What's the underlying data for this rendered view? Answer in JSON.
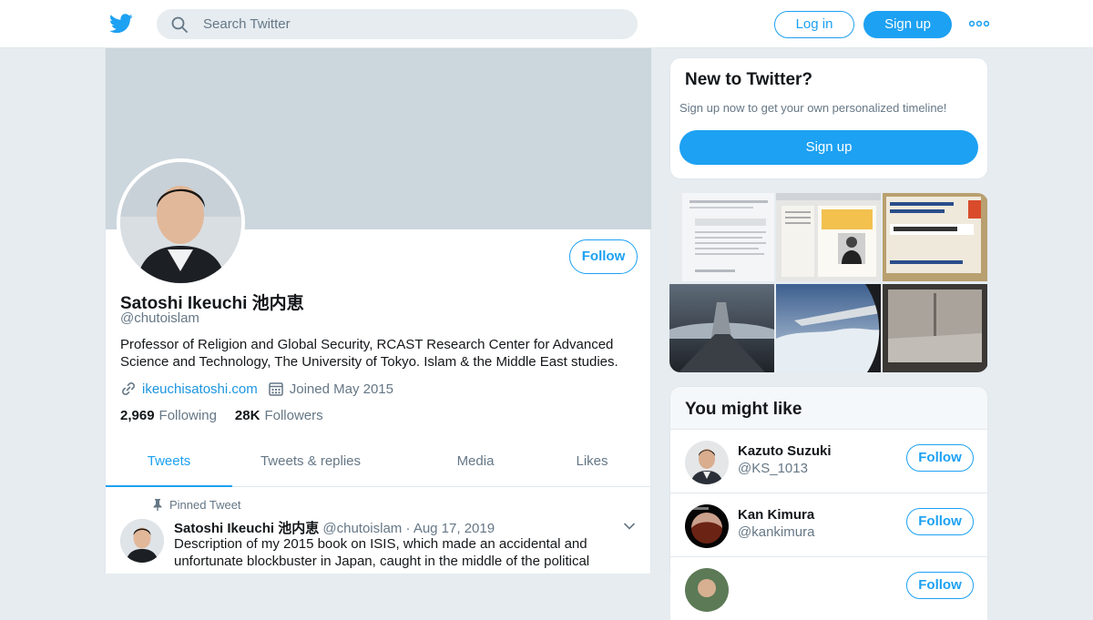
{
  "header": {
    "search_placeholder": "Search Twitter",
    "login_label": "Log in",
    "signup_label": "Sign up",
    "accent_color": "#1da1f2",
    "logo_icon": "twitter-bird-icon",
    "more_icon": "ellipsis-icon"
  },
  "profile": {
    "follow_label": "Follow",
    "name": "Satoshi Ikeuchi 池内恵",
    "handle": "@chutoislam",
    "bio": "Professor of Religion and Global Security, RCAST Research Center for Advanced Science and Technology, The University of Tokyo. Islam & the Middle East studies.",
    "website": "ikeuchisatoshi.com",
    "joined": "Joined May 2015",
    "following_count": "2,969",
    "following_label": "Following",
    "followers_count": "28K",
    "followers_label": "Followers"
  },
  "tabs": [
    {
      "label": "Tweets",
      "active": true
    },
    {
      "label": "Tweets & replies",
      "active": false
    },
    {
      "label": "Media",
      "active": false
    },
    {
      "label": "Likes",
      "active": false
    }
  ],
  "pinned_tweet": {
    "pin_label": "Pinned Tweet",
    "author_name": "Satoshi Ikeuchi 池内恵",
    "author_handle": "@chutoislam",
    "separator": "·",
    "date": "Aug 17, 2019",
    "text": "Description of my 2015 book on ISIS, which made an accidental and unfortunate blockbuster in Japan, caught in the middle of the political"
  },
  "new_to_twitter": {
    "title": "New to Twitter?",
    "subtitle": "Sign up now to get your own personalized timeline!",
    "signup_label": "Sign up"
  },
  "you_might_like": {
    "title": "You might like",
    "follow_label": "Follow",
    "accounts": [
      {
        "name": "Kazuto Suzuki",
        "handle": "@KS_1013"
      },
      {
        "name": "Kan Kimura",
        "handle": "@kankimura"
      }
    ]
  }
}
